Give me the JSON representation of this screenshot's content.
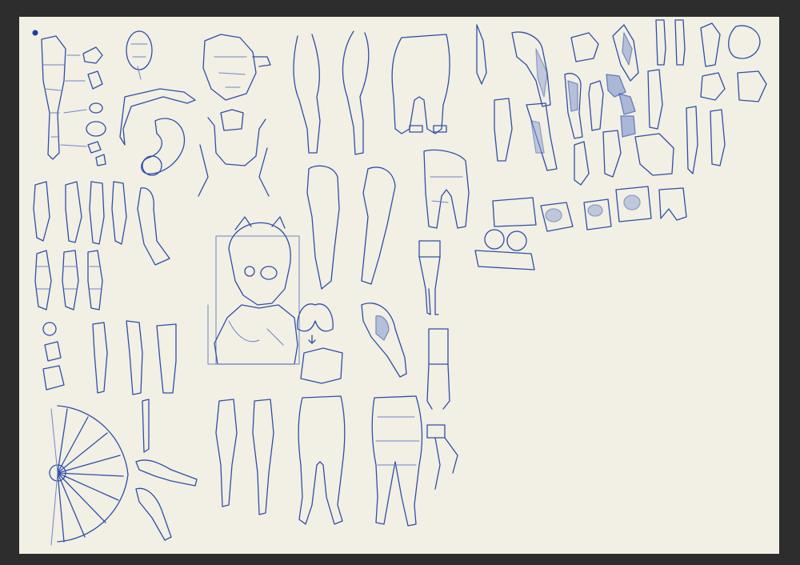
{
  "window": {
    "background_color": "#2d2d2d"
  },
  "canvas": {
    "paper_color": "#f2efe4",
    "ink_color": "#2f4fa8"
  },
  "sketches": [
    {
      "name": "leg-construction-with-forms",
      "icon": "leg-sketch"
    },
    {
      "name": "torso-sketch",
      "icon": "torso-sketch"
    },
    {
      "name": "flexed-arm-sketch",
      "icon": "arm-sketch"
    },
    {
      "name": "legs-side-views",
      "icon": "legs-sketch"
    },
    {
      "name": "pelvis-and-thighs-front",
      "icon": "pelvis-sketch"
    },
    {
      "name": "character-portrait-sketch",
      "icon": "portrait-sketch"
    },
    {
      "name": "mannequin-legs",
      "icon": "mannequin-sketch"
    },
    {
      "name": "arm-rotation-fan",
      "icon": "fan-sketch"
    },
    {
      "name": "leg-muscle-studies",
      "icon": "muscle-sketch"
    }
  ]
}
